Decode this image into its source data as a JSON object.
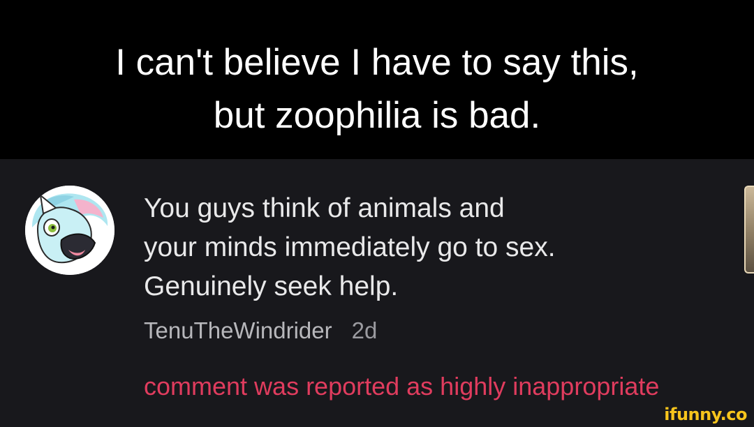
{
  "caption": {
    "line1": "I can't believe I have to say this,",
    "line2": "but zoophilia is bad."
  },
  "comment": {
    "text": "You guys think of animals and\nyour minds immediately go to sex.\nGenuinely seek help.",
    "username": "TenuTheWindrider",
    "age": "2d",
    "status": "comment was reported as highly inappropriate"
  },
  "watermark": "ifunny.co",
  "colors": {
    "caption_bg": "#000000",
    "comment_bg": "#18181c",
    "comment_text": "#e9e9ea",
    "meta_text": "#b7b7bb",
    "reported_text": "#e03c5e",
    "watermark": "#f7c51c"
  },
  "icons": {
    "avatar": "furry-bird-avatar",
    "side": "media-thumbnail"
  }
}
